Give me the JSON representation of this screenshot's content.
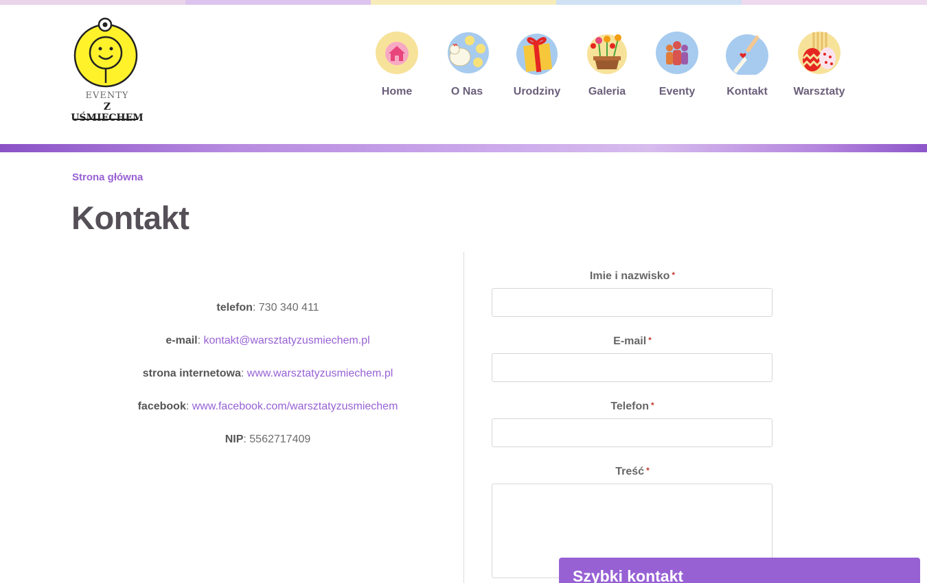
{
  "colors": {
    "accent": "#9761d4",
    "title": "#555057",
    "nav_label": "#6a5e7a",
    "top_strip": [
      "#ead4ea",
      "#dcc4ee",
      "#f7ecb9",
      "#cfe1f3",
      "#eed9ee"
    ]
  },
  "logo": {
    "line1": "EVENTY",
    "line2": "Z UŚMIECHEM",
    "icon": "smiley-face-icon"
  },
  "nav": {
    "items": [
      {
        "label": "Home",
        "icon": "house-icon"
      },
      {
        "label": "O Nas",
        "icon": "chickens-icon"
      },
      {
        "label": "Urodziny",
        "icon": "gift-icon"
      },
      {
        "label": "Galeria",
        "icon": "flower-pot-icon"
      },
      {
        "label": "Eventy",
        "icon": "people-icon"
      },
      {
        "label": "Kontakt",
        "icon": "hands-heart-icon"
      },
      {
        "label": "Warsztaty",
        "icon": "easter-eggs-icon"
      }
    ]
  },
  "breadcrumb": "Strona główna",
  "page_title": "Kontakt",
  "contact": {
    "phone_label": "telefon",
    "phone_value": "730 340 411",
    "email_label": "e-mail",
    "email_value": "kontakt@warsztatyzusmiechem.pl",
    "website_label": "strona internetowa",
    "website_value": "www.warsztatyzusmiechem.pl",
    "facebook_label": "facebook",
    "facebook_value": "www.facebook.com/warsztatyzusmiechem",
    "nip_label": "NIP",
    "nip_value": "5562717409"
  },
  "form": {
    "required_mark": "*",
    "name_label": "Imie i nazwisko",
    "email_label": "E-mail",
    "phone_label": "Telefon",
    "message_label": "Treść"
  },
  "quick_contact": "Szybki kontakt"
}
